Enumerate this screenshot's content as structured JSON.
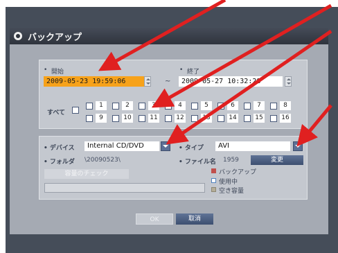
{
  "window": {
    "title": "バックアップ"
  },
  "time": {
    "start_label": "開始",
    "start_value": "2009-05-23 19:59:06",
    "separator": "~",
    "end_label": "終了",
    "end_value": "2009-05-27 10:32:28"
  },
  "channels": {
    "all_label": "すべて",
    "items": [
      "1",
      "2",
      "3",
      "4",
      "5",
      "6",
      "7",
      "8",
      "9",
      "10",
      "11",
      "12",
      "13",
      "14",
      "15",
      "16"
    ]
  },
  "device": {
    "device_label": "デバイス",
    "device_value": "Internal CD/DVD",
    "type_label": "タイプ",
    "type_value": "AVI",
    "folder_label": "フォルダ",
    "folder_value": "\\20090523\\",
    "filename_label": "ファイル名",
    "filename_value": "1959",
    "change_button": "変更",
    "capacity_check_button": "容量のチェック",
    "legend": [
      "バックアップ",
      "使用中",
      "空き容量"
    ]
  },
  "footer": {
    "ok_button": "OK",
    "cancel_button": "取消"
  },
  "colors": {
    "highlight": "#f7a21a",
    "accent_red": "#e02020",
    "legend_backup": "#c0504d",
    "legend_used": "#4f81bd",
    "legend_free": "#a8a08a"
  }
}
